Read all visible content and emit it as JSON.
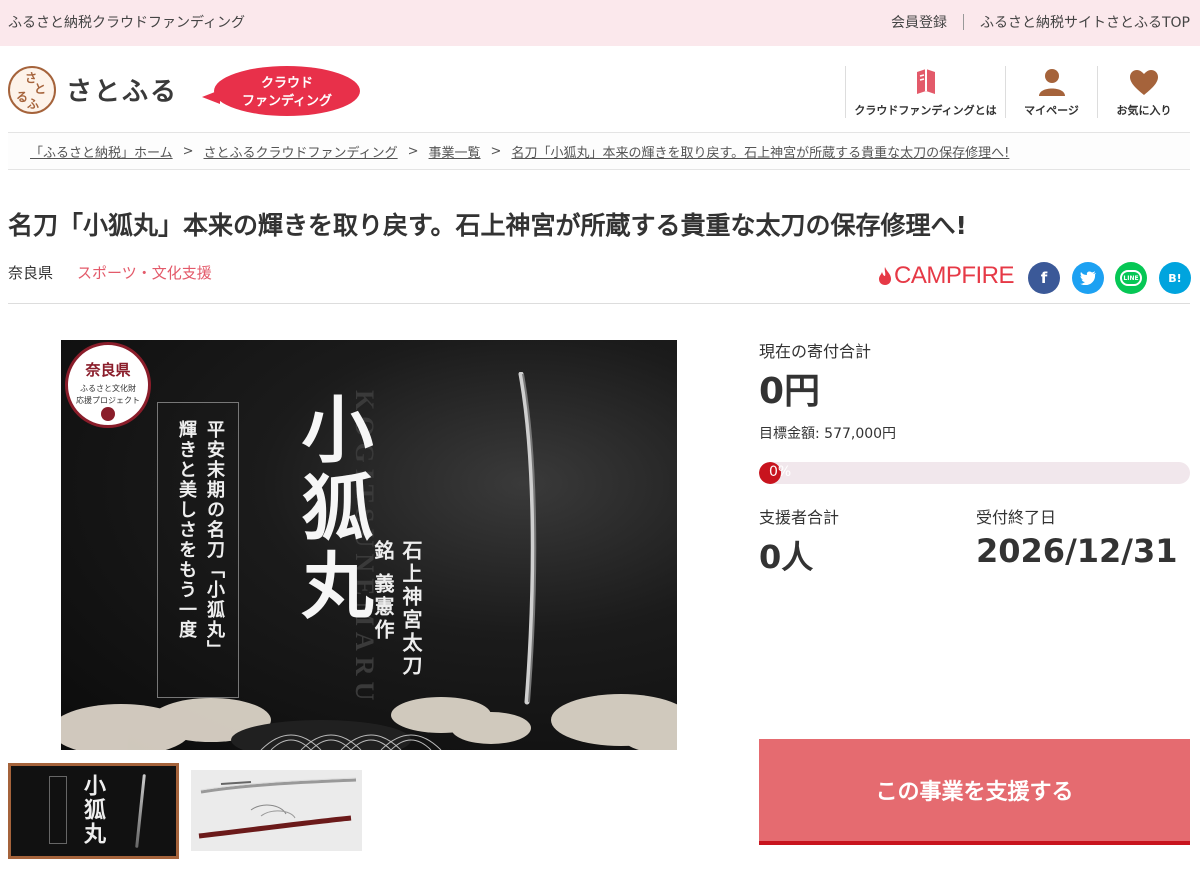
{
  "topbar": {
    "site_name": "ふるさと納税クラウドファンディング",
    "register": "会員登録",
    "site_top": "ふるさと納税サイトさとふるTOP"
  },
  "header": {
    "logo_text": "さとふる",
    "logo_seal_chars": [
      "さ",
      "と",
      "ふ",
      "る"
    ],
    "badge_line1": "クラウド",
    "badge_line2": "ファンディング",
    "nav": [
      {
        "label": "クラウドファンディングとは",
        "icon": "book-icon"
      },
      {
        "label": "マイページ",
        "icon": "user-icon"
      },
      {
        "label": "お気に入り",
        "icon": "heart-icon"
      }
    ]
  },
  "breadcrumb": [
    "「ふるさと納税」ホーム",
    "さとふるクラウドファンディング",
    "事業一覧",
    "名刀「小狐丸」本来の輝きを取り戻す。石上神宮が所蔵する貴重な太刀の保存修理へ!"
  ],
  "project": {
    "title": "名刀「小狐丸」本来の輝きを取り戻す。石上神宮が所蔵する貴重な太刀の保存修理へ!",
    "prefecture": "奈良県",
    "category": "スポーツ・文化支援",
    "partner": "CAMPFIRE"
  },
  "share": {
    "facebook": "f",
    "twitter": "t",
    "line": "LINE",
    "hatena": "B!"
  },
  "hero": {
    "stamp_pref": "奈良県",
    "stamp_line1": "ふるさと文化財",
    "stamp_line2": "応援プロジェクト",
    "subtitle1": "平安末期の名刀「小狐丸」",
    "subtitle2": "輝きと美しさをもう一度",
    "main_title": "小狐丸",
    "roman": "KOGITSUNEMARU",
    "line_tachi": "石上神宮太刀",
    "line_mei": "銘 義憲作"
  },
  "thumbs": {
    "t1_title": "小狐丸"
  },
  "stats": {
    "total_label": "現在の寄付合計",
    "total_value": "0円",
    "goal_text": "目標金額: 577,000円",
    "progress_text": "0%",
    "progress": 0,
    "supporters_label": "支援者合計",
    "supporters_value": "0人",
    "deadline_label": "受付終了日",
    "deadline_value": "2026/12/31"
  },
  "cta": {
    "label": "この事業を支援する"
  },
  "colors": {
    "accent": "#e56b70",
    "brand_red": "#c8141e",
    "topbar_bg": "#fbe8ec",
    "category": "#e35a6a"
  }
}
